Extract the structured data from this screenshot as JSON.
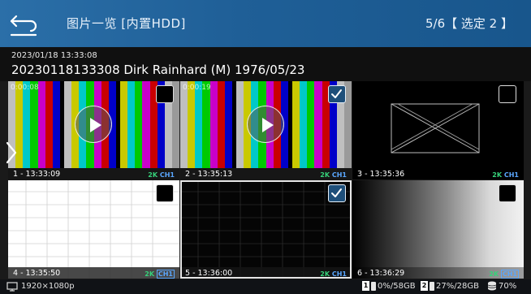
{
  "header": {
    "title": "图片一览 [内置HDD]",
    "page_status": "5/6【 选定 2 】"
  },
  "info": {
    "datetime": "2023/01/18 13:33:08",
    "patient_line": "20230118133308 Dirk Rainhard (M) 1976/05/23"
  },
  "colors": {
    "header_blue": "#2b6fa8",
    "badge_green": "#36d27a",
    "badge_blue": "#5aa7ff"
  },
  "thumbnails": [
    {
      "label": "1 - 13:33:09",
      "badge_res": "2K",
      "badge_ch": "CH1",
      "type": "video",
      "overlays": [
        "0:00:08"
      ],
      "checked": false
    },
    {
      "label": "2 - 13:35:13",
      "badge_res": "2K",
      "badge_ch": "CH1",
      "type": "video",
      "overlays": [
        "0:00:19"
      ],
      "checked": true
    },
    {
      "label": "3 - 13:35:36",
      "badge_res": "2K",
      "badge_ch": "CH1",
      "type": "image-crossed",
      "checked": false
    },
    {
      "label": "4 - 13:35:50",
      "badge_res": "2K",
      "badge_ch": "CH1",
      "type": "image-white-grid",
      "checked": false
    },
    {
      "label": "5 - 13:36:00",
      "badge_res": "2K",
      "badge_ch": "CH1",
      "type": "image-black-grid",
      "checked": true
    },
    {
      "label": "6 - 13:36:29",
      "badge_res": "2K",
      "badge_ch": "CH1",
      "type": "image-gradient",
      "checked": false
    }
  ],
  "footer": {
    "resolution": "1920×1080p",
    "slot1_num": "1",
    "slot1_usage": "0%/58GB",
    "slot2_num": "2",
    "slot2_usage": "27%/28GB",
    "internal_usage": "70%"
  },
  "icons": [
    "back-arrow-icon",
    "play-icon",
    "checkmark-icon",
    "chevron-right-icon",
    "monitor-icon",
    "sd-card-icon",
    "database-icon"
  ]
}
